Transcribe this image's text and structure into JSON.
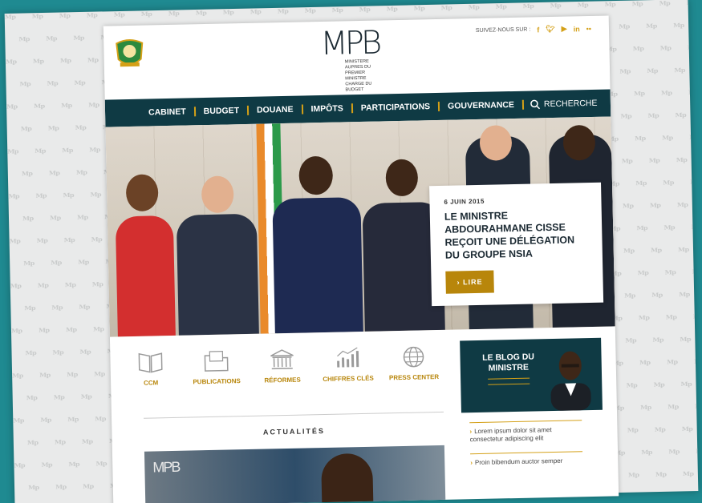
{
  "header": {
    "logo_text": "MPB",
    "logo_lines": [
      "MINISTERE",
      "AUPRES DU PREMIER MINISTRE",
      "CHARGE DU BUDGET"
    ],
    "social_label": "SUIVEZ-NOUS SUR :",
    "social_icons": [
      "facebook-icon",
      "twitter-icon",
      "youtube-icon",
      "linkedin-icon",
      "flickr-icon"
    ]
  },
  "nav": {
    "items": [
      "CABINET",
      "BUDGET",
      "DOUANE",
      "IMPÔTS",
      "PARTICIPATIONS",
      "GOUVERNANCE"
    ],
    "search_label": "RECHERCHE"
  },
  "hero": {
    "date": "6 JUIN 2015",
    "headline": "LE MINISTRE ABDOURAHMANE CISSE REÇOIT UNE DÉLÉGATION DU GROUPE NSIA",
    "button": "› LIRE"
  },
  "quicklinks": [
    {
      "label": "CCM",
      "icon": "book-icon"
    },
    {
      "label": "PUBLICATIONS",
      "icon": "folder-icon"
    },
    {
      "label": "RÉFORMES",
      "icon": "building-icon"
    },
    {
      "label": "CHIFFRES CLÉS",
      "icon": "chart-icon"
    },
    {
      "label": "PRESS CENTER",
      "icon": "globe-icon"
    }
  ],
  "news": {
    "section_title": "ACTUALITÉS",
    "thumb_logo": "MPB"
  },
  "blog": {
    "title": "LE BLOG DU MINISTRE",
    "links": [
      "Lorem ipsum dolor sit amet consectetur adipiscing elit",
      "Proin bibendum auctor semper"
    ]
  },
  "colors": {
    "navy": "#0f3a44",
    "gold": "#b8860b",
    "teal_bg": "#1f8a91"
  }
}
